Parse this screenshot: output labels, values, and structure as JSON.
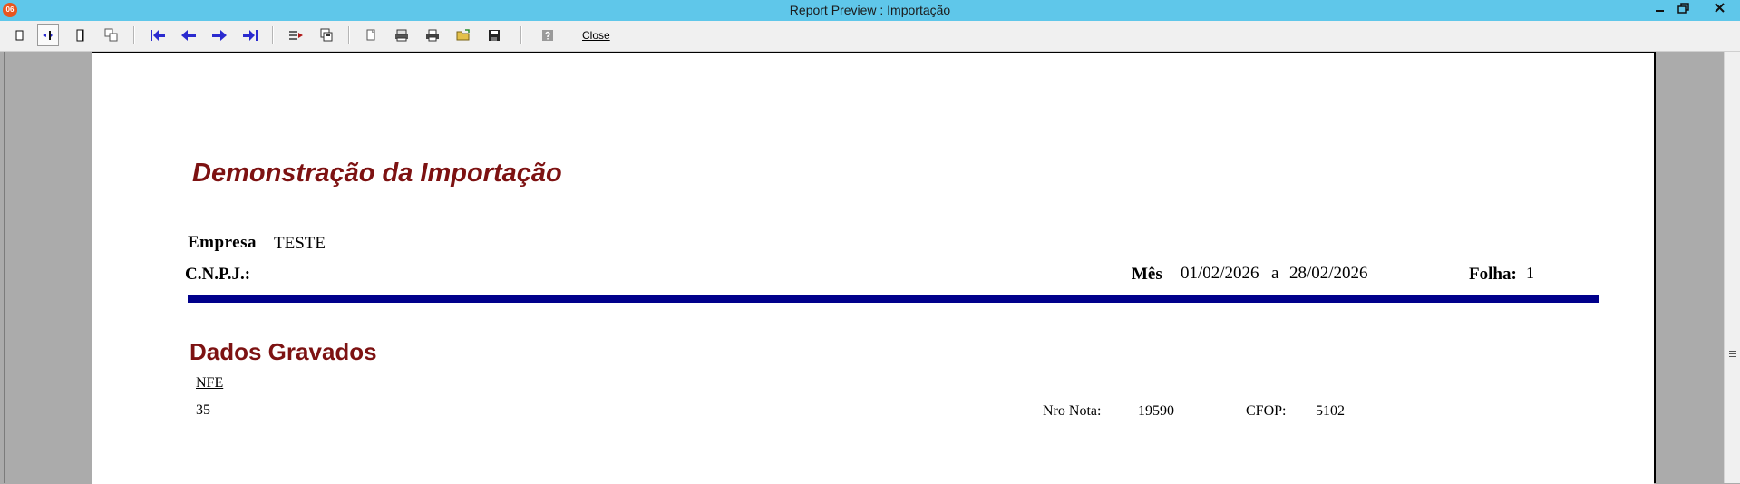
{
  "window": {
    "title": "Report Preview : Importação",
    "app_icon_text": "06"
  },
  "toolbar": {
    "close_label": "Close",
    "icons": [
      "single-page-icon",
      "page-width-icon",
      "full-page-icon",
      "multi-page-icon",
      "first-page-icon",
      "previous-page-icon",
      "next-page-icon",
      "last-page-icon",
      "goto-page-icon",
      "thumbnails-icon",
      "copy-icon",
      "print-setup-icon",
      "print-icon",
      "open-folder-icon",
      "save-icon",
      "help-icon"
    ]
  },
  "report": {
    "title": "Demonstração da Importação",
    "empresa_label": "Empresa",
    "empresa_value": "TESTE",
    "cnpj_label": "C.N.P.J.:",
    "mes_label": "Mês",
    "mes_start": "01/02/2026",
    "mes_sep": "a",
    "mes_end": "28/02/2026",
    "folha_label": "Folha:",
    "folha_value": "1",
    "bar_color": "#00008b",
    "title_color": "#7d1212",
    "section_title": "Dados Gravados",
    "nfe_header": "NFE",
    "row": {
      "code": "35",
      "nro_nota_label": "Nro Nota:",
      "nro_nota_value": "19590",
      "cfop_label": "CFOP:",
      "cfop_value": "5102"
    }
  }
}
